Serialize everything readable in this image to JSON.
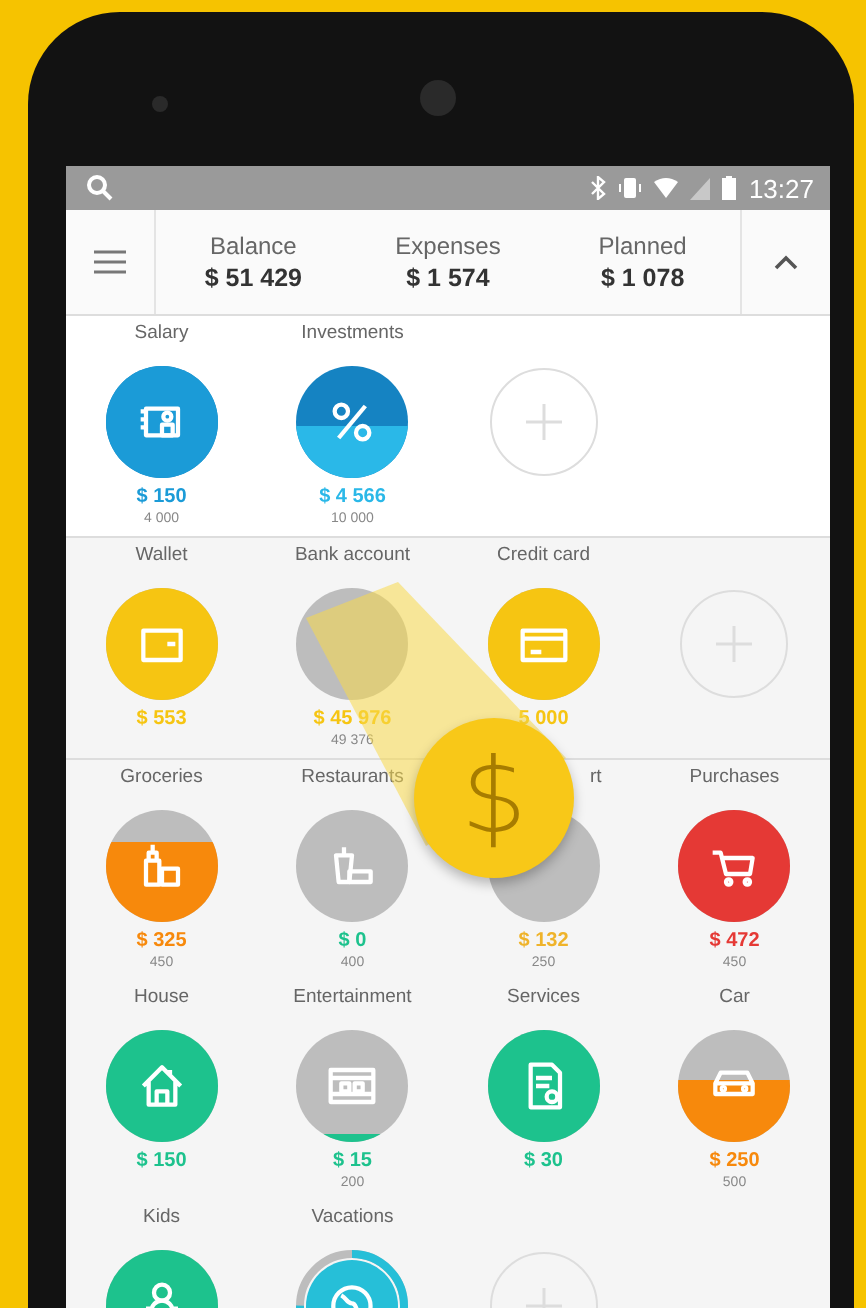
{
  "status_bar": {
    "time": "13:27"
  },
  "header": {
    "stats": [
      {
        "label": "Balance",
        "value": "$ 51 429"
      },
      {
        "label": "Expenses",
        "value": "$ 1 574"
      },
      {
        "label": "Planned",
        "value": "$ 1 078"
      }
    ]
  },
  "sections": [
    {
      "kind": "income",
      "items": [
        {
          "kind": "category",
          "name": "Salary",
          "amount": "$ 150",
          "limit": "4 000",
          "color": "#1b9bd7"
        },
        {
          "kind": "category",
          "name": "Investments",
          "amount": "$ 4 566",
          "limit": "10 000",
          "color": "#2ab8e8"
        },
        {
          "kind": "add"
        }
      ]
    },
    {
      "kind": "accounts",
      "items": [
        {
          "kind": "category",
          "name": "Wallet",
          "amount": "$ 553",
          "color": "#f6c512"
        },
        {
          "kind": "category",
          "name": "Bank account",
          "amount": "$ 45 976",
          "limit": "49 376",
          "color": "#f6c512"
        },
        {
          "kind": "category",
          "name": "Credit card",
          "amount": "5 000",
          "color": "#f6c512"
        },
        {
          "kind": "add"
        }
      ]
    },
    {
      "kind": "expenses",
      "items": [
        {
          "kind": "category",
          "name": "Groceries",
          "amount": "$ 325",
          "limit": "450",
          "color": "#f7890c"
        },
        {
          "kind": "category",
          "name": "Restaurants",
          "amount": "$ 0",
          "limit": "400",
          "color": "#1dc28d"
        },
        {
          "kind": "category",
          "name": "rt",
          "amount": "$ 132",
          "limit": "250",
          "color": "#efb32a"
        },
        {
          "kind": "category",
          "name": "Purchases",
          "amount": "$ 472",
          "limit": "450",
          "color": "#e53935"
        },
        {
          "kind": "category",
          "name": "House",
          "amount": "$ 150",
          "color": "#1dc28d"
        },
        {
          "kind": "category",
          "name": "Entertainment",
          "amount": "$ 15",
          "limit": "200",
          "color": "#1dc28d"
        },
        {
          "kind": "category",
          "name": "Services",
          "amount": "$ 30",
          "color": "#1dc28d"
        },
        {
          "kind": "category",
          "name": "Car",
          "amount": "$ 250",
          "limit": "500",
          "color": "#f7890c"
        },
        {
          "kind": "category",
          "name": "Kids",
          "color": "#1dc28d"
        },
        {
          "kind": "ring",
          "name": "Vacations",
          "color": "#26bfd8"
        },
        {
          "kind": "add"
        }
      ]
    }
  ],
  "coin": {
    "symbol": "$"
  }
}
